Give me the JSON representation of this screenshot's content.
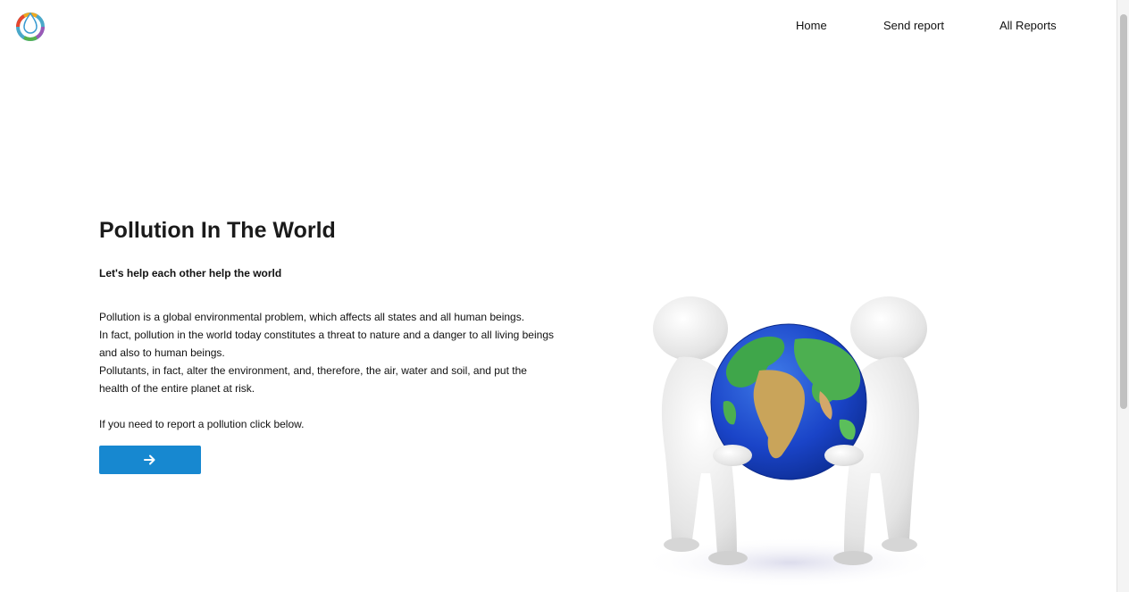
{
  "header": {
    "nav": [
      {
        "label": "Home"
      },
      {
        "label": "Send report"
      },
      {
        "label": "All Reports"
      }
    ]
  },
  "hero": {
    "title": "Pollution In The World",
    "subtitle": "Let's help each other help the world",
    "paragraphs": [
      "Pollution is a global environmental problem, which affects all states and all human beings.",
      "In fact, pollution in the world today constitutes a threat to nature and a danger to all living beings and also to human beings.",
      "Pollutants, in fact, alter the environment, and, therefore, the air, water and soil, and put the health of the entire planet at risk."
    ],
    "cta_text": "If you need to report a pollution click below.",
    "cta_button_icon": "arrow-right-icon"
  },
  "colors": {
    "accent": "#1788d0",
    "text": "#111111"
  }
}
